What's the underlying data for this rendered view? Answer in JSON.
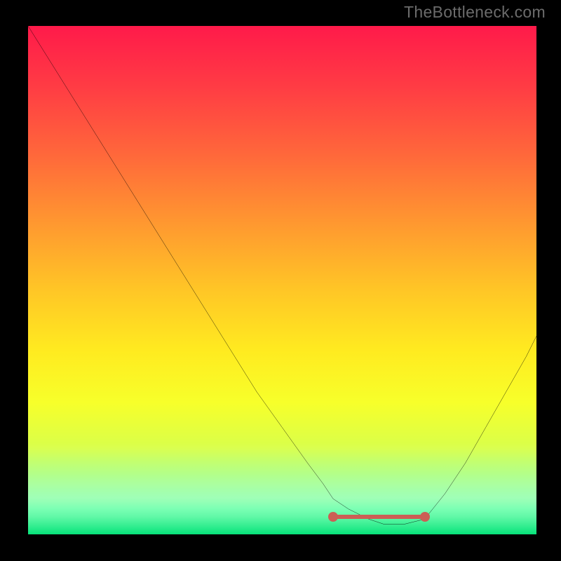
{
  "watermark": "TheBottleneck.com",
  "chart_data": {
    "type": "line",
    "title": "",
    "xlabel": "",
    "ylabel": "",
    "xlim": [
      0,
      100
    ],
    "ylim": [
      0,
      100
    ],
    "grid": false,
    "series": [
      {
        "name": "curve",
        "color": "#000000",
        "x": [
          0,
          5,
          10,
          15,
          20,
          25,
          30,
          35,
          40,
          45,
          50,
          55,
          58,
          60,
          63,
          67,
          70,
          74,
          78,
          82,
          86,
          90,
          94,
          98,
          100
        ],
        "y": [
          100,
          92,
          84,
          76,
          68,
          60,
          52,
          44,
          36,
          28,
          21,
          14,
          10,
          7,
          5,
          3,
          2,
          2,
          3,
          8,
          14,
          21,
          28,
          35,
          39
        ]
      }
    ],
    "annotations": [
      {
        "name": "tolerance-band",
        "type": "segment",
        "color": "#cc5f55",
        "x": [
          60,
          78
        ],
        "y": [
          3.5,
          3.5
        ]
      }
    ]
  }
}
